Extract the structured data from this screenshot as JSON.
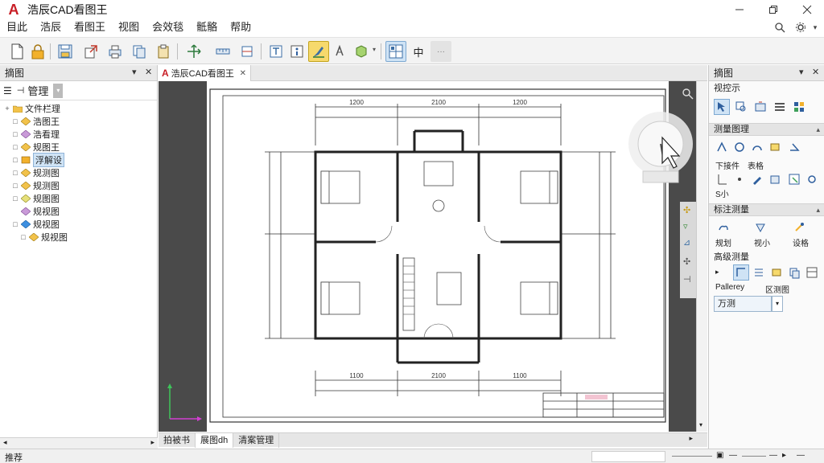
{
  "app": {
    "logo": "A",
    "title": "浩辰CAD看图王"
  },
  "menu": [
    "目此",
    "浩辰",
    "看图王",
    "视图",
    "会效毯",
    "骶骼",
    "帮助"
  ],
  "toolbar": {
    "buttons": [
      "new-file-icon",
      "open-file-icon",
      "save-icon",
      "export-icon",
      "print-icon",
      "copy-icon",
      "paste-icon",
      "move-icon",
      "measure-icon",
      "dimension-icon",
      "text-icon",
      "layer-icon",
      "highlight-icon",
      "annotate-icon",
      "block-icon",
      "grid-icon",
      "center-icon"
    ],
    "center_label": "中"
  },
  "left_panel": {
    "title": "摘图",
    "manager_label": "管理",
    "tree": [
      {
        "label": "文件栏理",
        "level": 0
      },
      {
        "label": "浩图王",
        "level": 1
      },
      {
        "label": "浩看理",
        "level": 1
      },
      {
        "label": "规图王",
        "level": 1
      },
      {
        "label": "浮解设",
        "level": 1,
        "selected": true
      },
      {
        "label": "规测图",
        "level": 1
      },
      {
        "label": "规测图",
        "level": 1
      },
      {
        "label": "规图图",
        "level": 1
      },
      {
        "label": "规视图",
        "level": 1
      },
      {
        "label": "规视图",
        "level": 1
      },
      {
        "label": "规视图",
        "level": 1
      }
    ]
  },
  "document_tab": {
    "logo": "A",
    "label": "浩辰CAD看图王"
  },
  "bottom_tabs": [
    "拍被书",
    "展图dh",
    "清案管理"
  ],
  "drawing": {
    "dims_top": [
      "1200",
      "2100",
      "1200"
    ],
    "dims_bottom": [
      "1100",
      "2100",
      "1100"
    ]
  },
  "right_panel": {
    "title": "摘图",
    "sections": [
      "视控示",
      "测量图理",
      "标注测量",
      "高级测量"
    ],
    "labels": {
      "sub_a": "下接件",
      "sub_b": "表格",
      "sub_c": "S小",
      "row_a": "规划",
      "row_b": "视小",
      "row_c": "设格",
      "polyline": "Pallerey",
      "polyline_b": "区测图",
      "combo": "万测"
    }
  },
  "status": {
    "text": "推荐"
  },
  "colors": {
    "brand": "#c81d25",
    "accent": "#cfe3f5",
    "canvas_bg": "#4a4a4a"
  }
}
